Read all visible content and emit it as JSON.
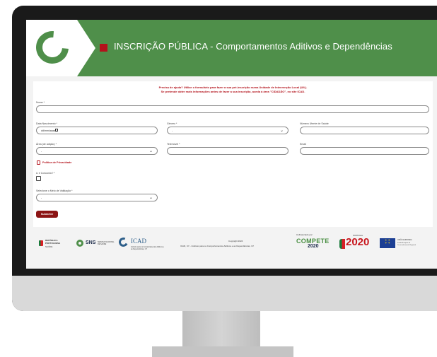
{
  "header": {
    "title": "INSCRIÇÃO PÚBLICA - Comportamentos Aditivos e Dependências"
  },
  "help": {
    "line1": "Precisa de ajuda? Utilize o formulário para fazer a sua pré-inscrição numa Unidade de Intervenção Local (UIL).",
    "line2": "Se pretende obter mais informações antes de fazer a sua inscrição, aceda à área \"CIDADÃO\", no site ICAD."
  },
  "form": {
    "nome_label": "Nome *",
    "nascimento_label": "Data Nascimento *",
    "nascimento_value": "dd/mm/aaaa",
    "genero_label": "Género *",
    "genero_value": "-",
    "utente_label": "Número Utente de Saúde",
    "area_label": "Área (de adição) *",
    "area_value": "-",
    "telemovel_label": "Telemóvel *",
    "email_label": "Email",
    "privacy_label": "Política de Privacidade",
    "consent_label": "Li e Concordo? *",
    "validation_label": "Selecione o Meio de Validação *",
    "validation_value": "-",
    "submit_label": "Submeter"
  },
  "footer": {
    "republica": "REPÚBLICA PORTUGUESA",
    "republica_sub": "SAÚDE",
    "sns": "SNS",
    "sns_sub": "SERVIÇO NACIONAL DE SAÚDE",
    "icad": "ICAD",
    "icad_sub": "Instituto para os Comportamentos Aditivos e as Dependências, I.P.",
    "copyright": "Copyright 2024",
    "copyright_sub": "ICAD, I.P. - Instituto para os Comportamentos Aditivos e as Dependências, I.P.",
    "cofinanciado": "Cofinanciado por:",
    "compete": "COMPETE",
    "compete_year": "2020",
    "portugal": "PORTUGAL",
    "portugal_year": "2020",
    "eu": "UNIÃO EUROPEIA",
    "eu_sub": "Fundo Europeu de Desenvolvimento Regional"
  }
}
